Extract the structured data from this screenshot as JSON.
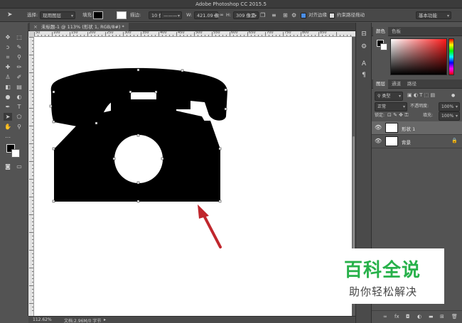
{
  "titlebar": {
    "title": "Adobe Photoshop CC 2015.5"
  },
  "options": {
    "select_label": "选择:",
    "select_value": "现用图层",
    "fill_label": "填充:",
    "stroke_label": "描边:",
    "stroke_width": "10 像素",
    "w_label": "W:",
    "w_value": "421.09 像",
    "h_label": "H:",
    "h_value": "309 像素",
    "align_edges": "对齐边缘",
    "constrain_path": "约束路径拖动",
    "workspace": "基本功能"
  },
  "document": {
    "tab_title": "未标题-1 @ 113% (形状 1, RGB/8#) *",
    "zoom": "112.62%",
    "doc_info": "文档:2.96M/0 字节",
    "ruler_labels": [
      "50",
      "100",
      "150",
      "200",
      "250",
      "300",
      "350",
      "400",
      "450",
      "500",
      "550",
      "600",
      "650",
      "700",
      "750",
      "800",
      "850"
    ]
  },
  "panels": {
    "color_tab": "颜色",
    "swatches_tab": "色板",
    "layers_tab": "图层",
    "channels_tab": "通道",
    "paths_tab": "路径",
    "kind_filter": "类型",
    "blend_mode": "正常",
    "opacity_label": "不透明度:",
    "opacity_value": "100%",
    "lock_label": "锁定:",
    "fill_label": "填充:",
    "fill_value": "100%",
    "layers": [
      {
        "name": "形状 1",
        "selected": true
      },
      {
        "name": "背景",
        "locked": true
      }
    ]
  },
  "watermark": {
    "title": "百科全说",
    "subtitle": "助你轻松解决"
  },
  "colors": {
    "accent_green": "#27b14a",
    "arrow_red": "#c0272d"
  }
}
